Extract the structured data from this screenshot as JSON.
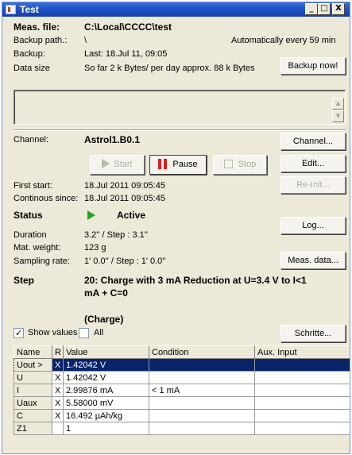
{
  "window": {
    "title": "Test",
    "controls": {
      "minimize": "_",
      "maximize": "□",
      "close": "X"
    }
  },
  "meas_file": {
    "label": "Meas. file:",
    "value": "C:\\Local\\CCCC\\test"
  },
  "backup_path": {
    "label": "Backup path.:",
    "value": "\\",
    "auto_text": "Automatically every 59 min"
  },
  "backup": {
    "label": "Backup:",
    "value": "Last: 18.Jul 11, 09:05",
    "button": "Backup now!"
  },
  "data_size": {
    "label": "Data size",
    "value": "So far 2 k Bytes/ per day approx. 88 k Bytes"
  },
  "channel": {
    "label": "Channel:",
    "value": "Astrol1.B0.1",
    "button": "Channel..."
  },
  "controls": {
    "start": "Start",
    "pause": "Pause",
    "stop": "Stop",
    "edit": "Edit...",
    "reinit": "Re-Init..."
  },
  "first_start": {
    "label": "First start:",
    "value": "18.Jul 2011 09:05:45"
  },
  "continuous_since": {
    "label": "Continous since:",
    "value": "18.Jul 2011 09:05:45"
  },
  "status": {
    "label": "Status",
    "value": "Active",
    "button": "Log...",
    "color": "#23a323"
  },
  "duration": {
    "label": "Duration",
    "value": "3.2'' / Step : 3.1''"
  },
  "mat_weight": {
    "label": "Mat. weight:",
    "value": "123 g"
  },
  "sampling_rate": {
    "label": "Sampling rate:",
    "value": "1' 0.0'' / Step : 1' 0.0''",
    "button": "Meas. data..."
  },
  "step": {
    "label": "Step",
    "value_line1": "20: Charge with 3 mA Reduction at U=3.4 V to I<1",
    "value_line2": "mA + C=0",
    "mode": "(Charge)"
  },
  "show_values": {
    "label": "Show values",
    "checked": "✓",
    "all_label": "All",
    "schritte_button": "Schritte..."
  },
  "table": {
    "headers": [
      "Name",
      "R",
      "Value",
      "Condition",
      "Aux. Input"
    ],
    "rows": [
      {
        "name": "Uout >",
        "r": "X",
        "value": "1.42042 V",
        "condition": "",
        "aux": ""
      },
      {
        "name": "U",
        "r": "X",
        "value": "1.42042 V",
        "condition": "",
        "aux": ""
      },
      {
        "name": "I",
        "r": "X",
        "value": "2.99876 mA",
        "condition": "< 1 mA",
        "aux": ""
      },
      {
        "name": "Uaux",
        "r": "X",
        "value": "5.58000 mV",
        "condition": "",
        "aux": ""
      },
      {
        "name": "C",
        "r": "X",
        "value": "16.492 µAh/kg",
        "condition": "",
        "aux": ""
      },
      {
        "name": "Z1",
        "r": "",
        "value": "1",
        "condition": "",
        "aux": ""
      }
    ]
  }
}
